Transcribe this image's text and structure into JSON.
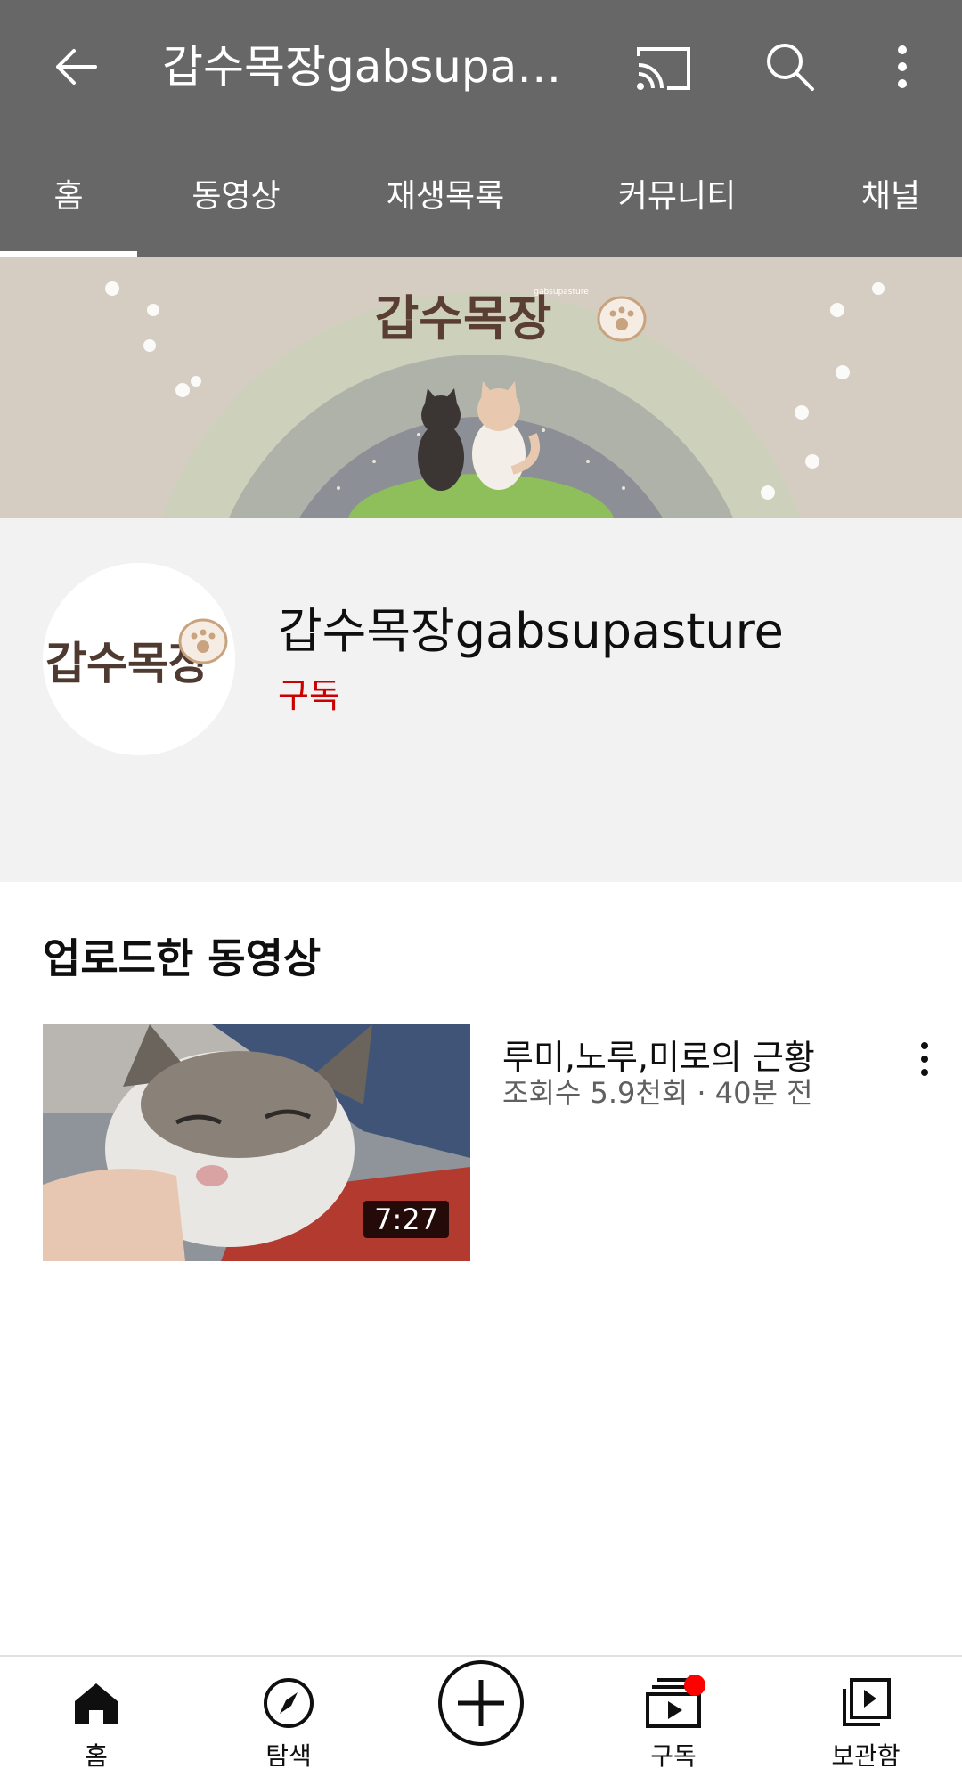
{
  "appbar": {
    "title": "갑수목장gabsupa…"
  },
  "tabs": [
    {
      "label": "홈",
      "active": true
    },
    {
      "label": "동영상",
      "active": false
    },
    {
      "label": "재생목록",
      "active": false
    },
    {
      "label": "커뮤니티",
      "active": false
    },
    {
      "label": "채널",
      "active": false
    }
  ],
  "banner": {
    "channel_logo_text": "갑수목장",
    "logo_small_text": "gabsupasture"
  },
  "channel": {
    "name": "갑수목장gabsupasture",
    "subscribe_label": "구독",
    "avatar_text": "갑수목장"
  },
  "uploads": {
    "section_title": "업로드한 동영상",
    "videos": [
      {
        "title": "루미,노루,미로의 근황",
        "meta": "조회수 5.9천회 · 40분 전",
        "duration": "7:27"
      }
    ]
  },
  "bottom_nav": [
    {
      "label": "홈",
      "icon": "home-icon"
    },
    {
      "label": "탐색",
      "icon": "compass-icon"
    },
    {
      "label": "",
      "icon": "create-icon"
    },
    {
      "label": "구독",
      "icon": "subscriptions-icon",
      "notification_dot": true
    },
    {
      "label": "보관함",
      "icon": "library-icon"
    }
  ],
  "colors": {
    "appbar_bg": "#676767",
    "subscribe_red": "#cc0000",
    "channel_header_bg": "#f2f2f2",
    "notification_red": "#ff0000"
  }
}
